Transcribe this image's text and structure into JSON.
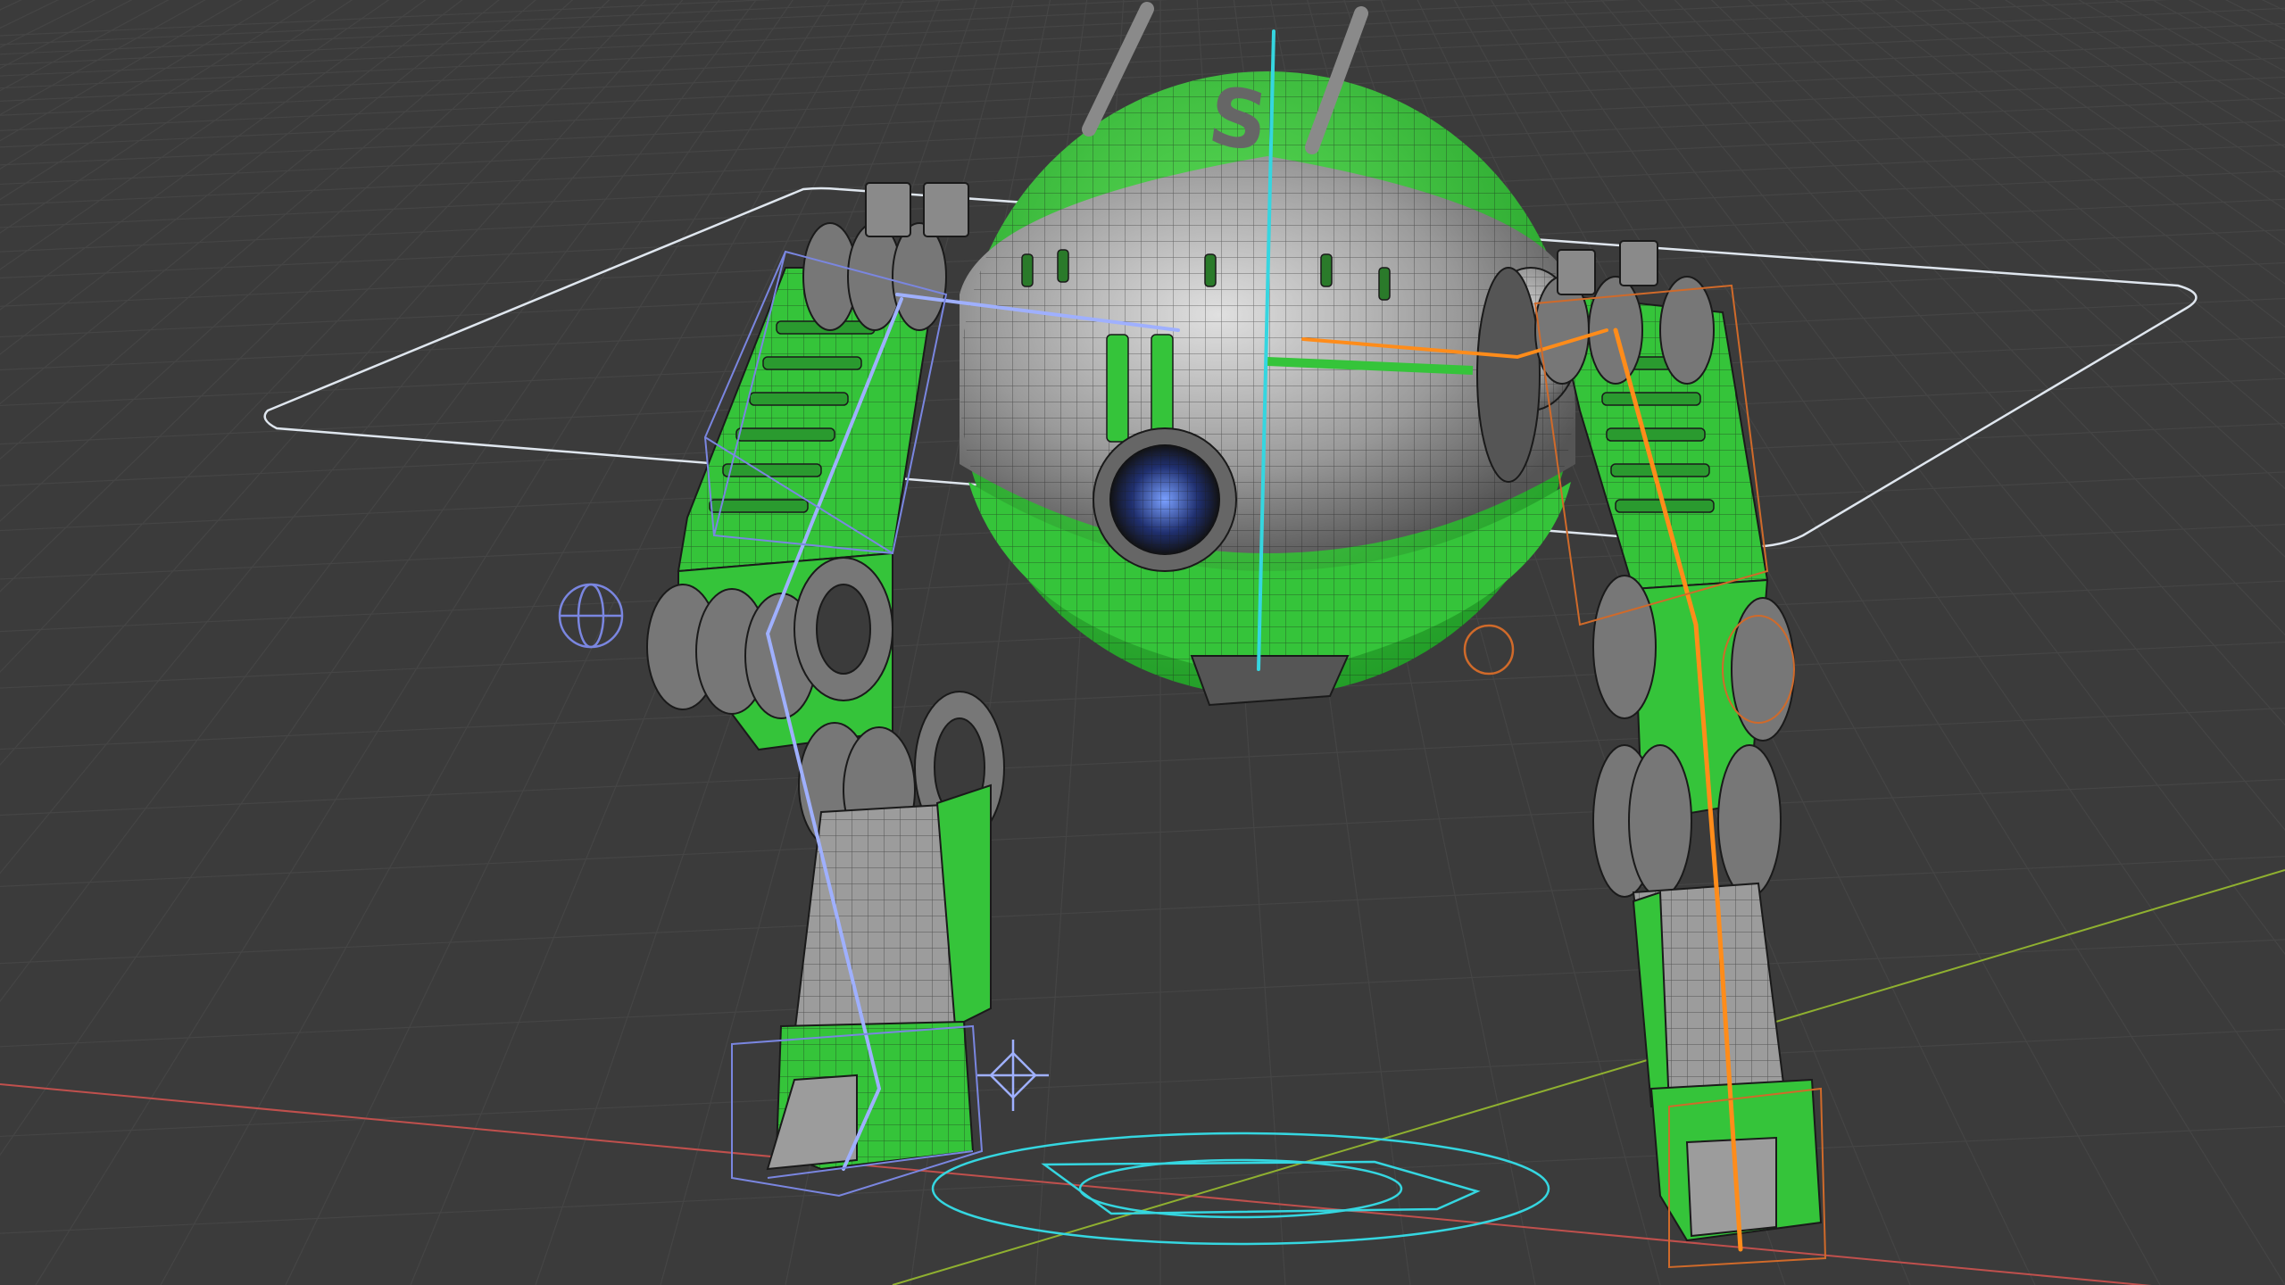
{
  "viewport": {
    "background": "#3b3b3b",
    "grid_color": "#454545",
    "x_axis_color": "#c0504d",
    "y_axis_color": "#8fb030",
    "selected_color": "#ff8c1a",
    "active_rig_color": "#9fb0ff",
    "cyan_control_color": "#35d6e0",
    "mesh_green": "#35c43a",
    "mesh_grey": "#9c9c9c"
  },
  "scene": {
    "object": "robot-mech-walker",
    "emblem_glyph": "S",
    "icons": [
      "empty-sphere-icon",
      "3d-cursor-icon",
      "ik-target-icon"
    ]
  }
}
